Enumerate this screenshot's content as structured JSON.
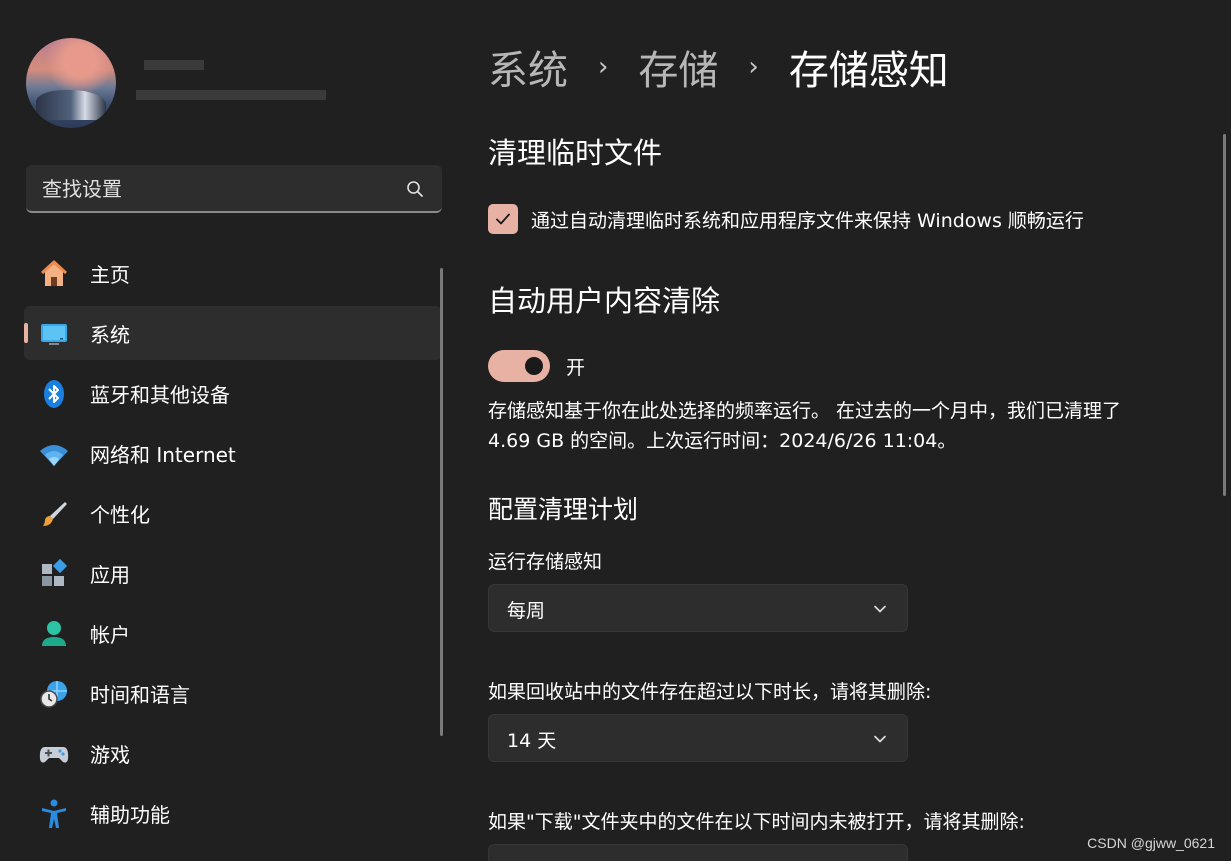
{
  "sidebar": {
    "search_placeholder": "查找设置",
    "items": [
      {
        "label": "主页",
        "icon": "home-icon"
      },
      {
        "label": "系统",
        "icon": "system-monitor-icon",
        "selected": true
      },
      {
        "label": "蓝牙和其他设备",
        "icon": "bluetooth-icon"
      },
      {
        "label": "网络和 Internet",
        "icon": "wifi-icon"
      },
      {
        "label": "个性化",
        "icon": "brush-icon"
      },
      {
        "label": "应用",
        "icon": "apps-icon"
      },
      {
        "label": "帐户",
        "icon": "account-icon"
      },
      {
        "label": "时间和语言",
        "icon": "time-language-icon"
      },
      {
        "label": "游戏",
        "icon": "gamepad-icon"
      },
      {
        "label": "辅助功能",
        "icon": "accessibility-icon"
      }
    ]
  },
  "breadcrumb": {
    "items": [
      "系统",
      "存储",
      "存储感知"
    ],
    "separator": "›"
  },
  "temp_files": {
    "title": "清理临时文件",
    "checkbox_label": "通过自动清理临时系统和应用程序文件来保持 Windows 顺畅运行",
    "checked": true
  },
  "auto_cleanup": {
    "title": "自动用户内容清除",
    "toggle_state": "开",
    "description": "存储感知基于你在此处选择的频率运行。 在过去的一个月中，我们已清理了 4.69 GB 的空间。上次运行时间：2024/6/26 11:04。"
  },
  "schedule": {
    "title": "配置清理计划",
    "run_label": "运行存储感知",
    "run_value": "每周",
    "recycle_label": "如果回收站中的文件存在超过以下时长，请将其删除:",
    "recycle_value": "14 天",
    "downloads_label": "如果\"下载\"文件夹中的文件在以下时间内未被打开，请将其删除:"
  },
  "watermark": "CSDN @gjww_0621",
  "colors": {
    "accent": "#e7b1a4",
    "background": "#202020",
    "surface": "#2d2d2d"
  }
}
